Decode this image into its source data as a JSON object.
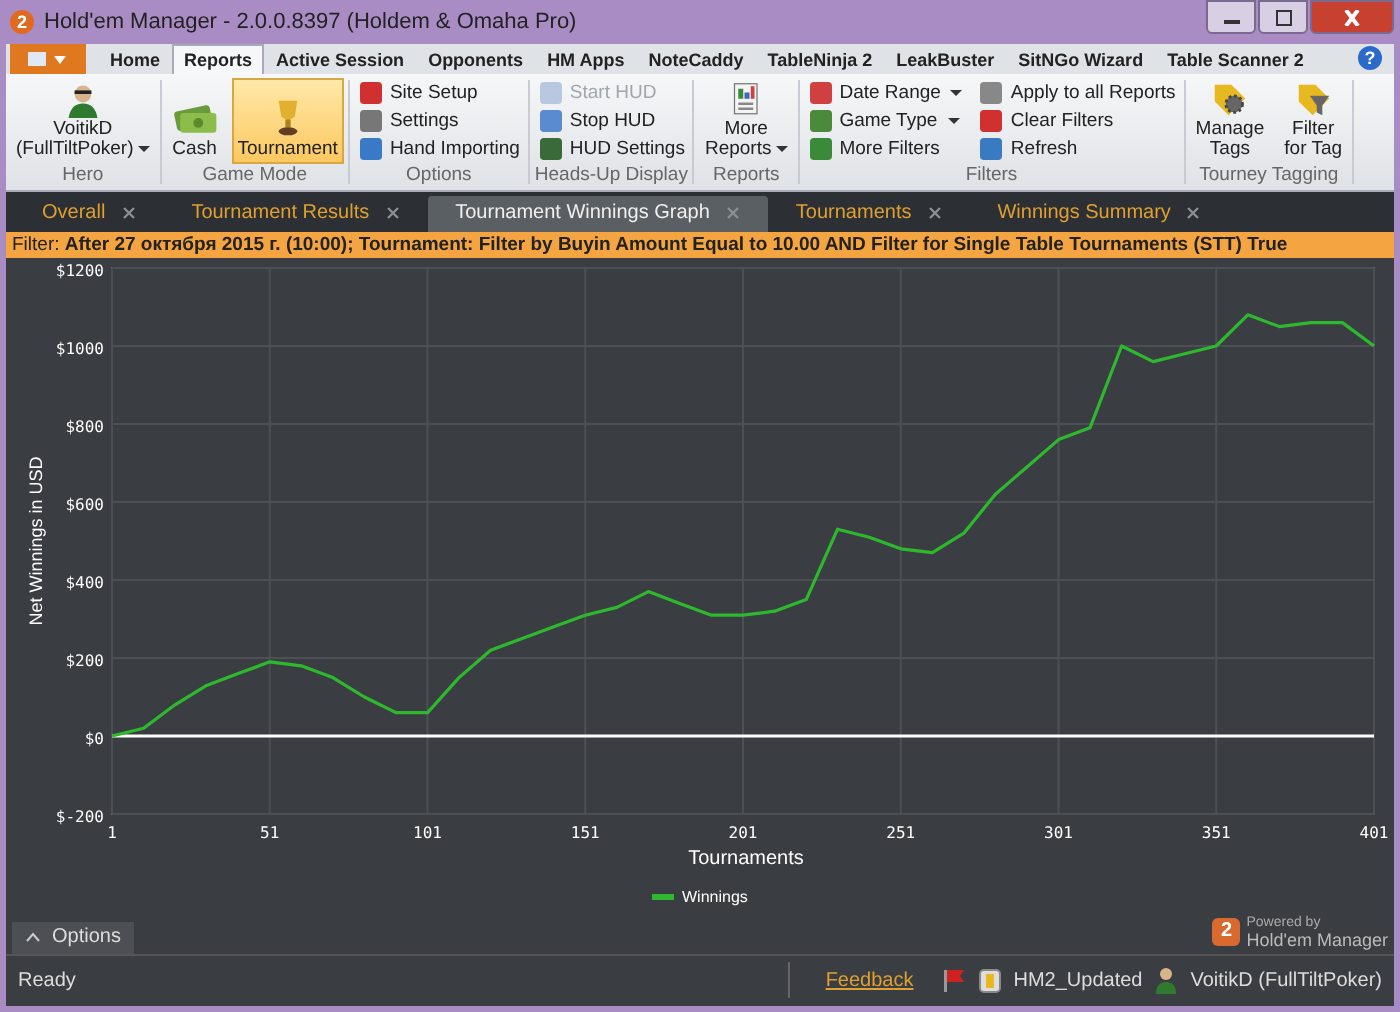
{
  "window": {
    "app_badge": "2",
    "title": "Hold'em Manager - 2.0.0.8397 (Holdem & Omaha Pro)"
  },
  "ribbon_tabs": [
    {
      "label": "Home",
      "selected": false
    },
    {
      "label": "Reports",
      "selected": true
    },
    {
      "label": "Active Session",
      "selected": false
    },
    {
      "label": "Opponents",
      "selected": false
    },
    {
      "label": "HM Apps",
      "selected": false
    },
    {
      "label": "NoteCaddy",
      "selected": false
    },
    {
      "label": "TableNinja 2",
      "selected": false
    },
    {
      "label": "LeakBuster",
      "selected": false
    },
    {
      "label": "SitNGo Wizard",
      "selected": false
    },
    {
      "label": "Table Scanner 2",
      "selected": false
    }
  ],
  "help": "?",
  "ribbon_groups": [
    {
      "label": "Hero",
      "columns": [
        [
          {
            "kind": "large",
            "lines": [
              "VoitikD",
              "(FullTiltPoker)"
            ],
            "dropdown": true,
            "selected": false,
            "disabled": false
          }
        ]
      ]
    },
    {
      "label": "Game Mode",
      "columns": [
        [
          {
            "kind": "large",
            "lines": [
              "Cash"
            ],
            "dropdown": false,
            "selected": false,
            "disabled": false
          }
        ],
        [
          {
            "kind": "large",
            "lines": [
              "Tournament"
            ],
            "dropdown": false,
            "selected": true,
            "disabled": false
          }
        ]
      ]
    },
    {
      "label": "Options",
      "columns": [
        [
          {
            "kind": "small",
            "label": "Site Setup",
            "dropdown": false,
            "selected": false,
            "disabled": false
          },
          {
            "kind": "small",
            "label": "Settings",
            "dropdown": false,
            "selected": false,
            "disabled": false
          },
          {
            "kind": "small",
            "label": "Hand Importing",
            "dropdown": false,
            "selected": false,
            "disabled": false
          }
        ]
      ]
    },
    {
      "label": "Heads-Up Display",
      "columns": [
        [
          {
            "kind": "small",
            "label": "Start HUD",
            "dropdown": false,
            "selected": false,
            "disabled": true
          },
          {
            "kind": "small",
            "label": "Stop HUD",
            "dropdown": false,
            "selected": false,
            "disabled": false
          },
          {
            "kind": "small",
            "label": "HUD Settings",
            "dropdown": false,
            "selected": false,
            "disabled": false
          }
        ]
      ]
    },
    {
      "label": "Reports",
      "columns": [
        [
          {
            "kind": "large",
            "lines": [
              "More",
              "Reports"
            ],
            "dropdown": true,
            "selected": false,
            "disabled": false
          }
        ]
      ]
    },
    {
      "label": "Filters",
      "columns": [
        [
          {
            "kind": "small",
            "label": "Date Range",
            "dropdown": true,
            "selected": false,
            "disabled": false
          },
          {
            "kind": "small",
            "label": "Game Type",
            "dropdown": true,
            "selected": false,
            "disabled": false
          },
          {
            "kind": "small",
            "label": "More Filters",
            "dropdown": false,
            "selected": false,
            "disabled": false
          }
        ],
        [
          {
            "kind": "small",
            "label": "Apply to all Reports",
            "dropdown": false,
            "selected": false,
            "disabled": false
          },
          {
            "kind": "small",
            "label": "Clear Filters",
            "dropdown": false,
            "selected": false,
            "disabled": false
          },
          {
            "kind": "small",
            "label": "Refresh",
            "dropdown": false,
            "selected": false,
            "disabled": false
          }
        ]
      ]
    },
    {
      "label": "Tourney Tagging",
      "columns": [
        [
          {
            "kind": "large",
            "lines": [
              "Manage",
              "Tags"
            ],
            "dropdown": false,
            "selected": false,
            "disabled": false
          }
        ],
        [
          {
            "kind": "large",
            "lines": [
              "Filter",
              "for Tag"
            ],
            "dropdown": false,
            "selected": false,
            "disabled": false
          }
        ]
      ]
    }
  ],
  "doc_tabs": [
    {
      "label": "Overall",
      "selected": false
    },
    {
      "label": "Tournament Results",
      "selected": false
    },
    {
      "label": "Tournament Winnings Graph",
      "selected": true
    },
    {
      "label": "Tournaments",
      "selected": false
    },
    {
      "label": "Winnings Summary",
      "selected": false
    }
  ],
  "filter_bar": "Filter: **After 27 октября 2015 г. (10:00); Tournament: Filter by Buyin Amount Equal to 10.00 AND Filter for Single Table Tournaments (STT) True**",
  "chart": {
    "chart_data": {
      "type": "line",
      "xlabel": "Tournaments",
      "ylabel": "Net Winnings in USD",
      "x": [
        1,
        11,
        21,
        31,
        41,
        51,
        61,
        71,
        81,
        91,
        101,
        111,
        121,
        131,
        141,
        151,
        161,
        171,
        181,
        191,
        201,
        211,
        221,
        231,
        241,
        251,
        261,
        271,
        281,
        291,
        301,
        311,
        321,
        331,
        341,
        351,
        361,
        371,
        381,
        391,
        401
      ],
      "series": [
        {
          "name": "Winnings",
          "color": "#2eb82e",
          "values": [
            0,
            20,
            80,
            130,
            160,
            190,
            180,
            150,
            100,
            60,
            60,
            150,
            220,
            250,
            280,
            310,
            330,
            370,
            340,
            310,
            310,
            320,
            350,
            530,
            510,
            480,
            470,
            520,
            620,
            690,
            760,
            790,
            1000,
            960,
            980,
            1000,
            1080,
            1050,
            1060,
            1060,
            1000
          ]
        }
      ],
      "grid": true,
      "xlim": [
        1,
        401
      ],
      "ylim": [
        -200,
        1200
      ],
      "xticks": [
        1,
        51,
        101,
        151,
        201,
        251,
        301,
        351,
        401
      ],
      "yticks": [
        {
          "value": -200,
          "label": "$-200"
        },
        {
          "value": 0,
          "label": "$0"
        },
        {
          "value": 200,
          "label": "$200"
        },
        {
          "value": 400,
          "label": "$400"
        },
        {
          "value": 600,
          "label": "$600"
        },
        {
          "value": 800,
          "label": "$800"
        },
        {
          "value": 1000,
          "label": "$1000"
        },
        {
          "value": 1200,
          "label": "$1200"
        }
      ]
    }
  },
  "options_button": "Options",
  "logo": {
    "badge": "2",
    "powered": "Powered by",
    "name": "Hold'em Manager"
  },
  "status_bar": {
    "status": "Ready",
    "feedback": "Feedback",
    "database": "HM2_Updated",
    "player": "VoitikD (FullTiltPoker)"
  }
}
